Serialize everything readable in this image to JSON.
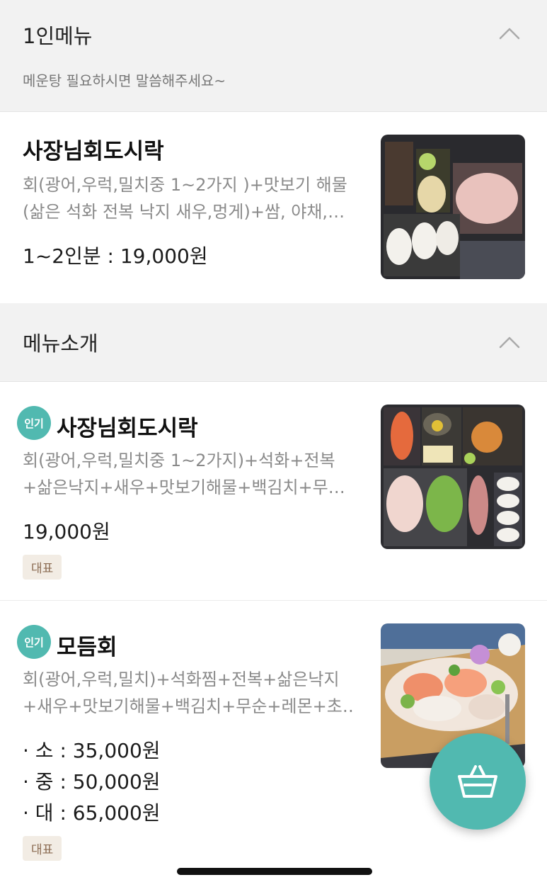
{
  "sections": [
    {
      "title": "1인메뉴",
      "subtitle": "메운탕 필요하시면 말씀해주세요~",
      "items": [
        {
          "name": "사장님회도시락",
          "desc_line1": "회(광어,우럭,밀치중 1~2가지 )+맛보기 해물",
          "desc_line2": "(삶은 석화 전복 낙지 새우,멍게)+쌈, 야채,…",
          "price": "1~2인분 : 19,000원"
        }
      ]
    },
    {
      "title": "메뉴소개",
      "items": [
        {
          "badge": "인기",
          "name": "사장님회도시락",
          "desc_line1": "회(광어,우럭,밀치중 1~2가지)+석화+전복",
          "desc_line2": "+삶은낙지+새우+맛보기해물+백김치+무…",
          "price": "19,000원",
          "tag": "대표"
        },
        {
          "badge": "인기",
          "name": "모듬회",
          "desc_line1": "회(광어,우럭,밀치)+석화찜+전복+삶은낙지",
          "desc_line2": "+새우+맛보기해물+백김치+무순+레몬+초…",
          "prices": [
            "· 소 : 35,000원",
            "· 중 : 50,000원",
            "· 대 : 65,000원"
          ],
          "tag": "대표"
        }
      ]
    }
  ],
  "icons": {
    "collapse": "chevron-up-icon",
    "cart": "basket-icon"
  },
  "colors": {
    "accent": "#51b9b0",
    "tag_bg": "#f2ece4",
    "tag_text": "#8b6b52"
  }
}
